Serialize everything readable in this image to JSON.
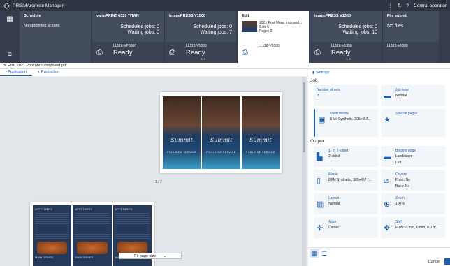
{
  "app": {
    "title": "PRISMAremote Manager",
    "user_menu": "Central operator"
  },
  "dashboard": {
    "schedule": {
      "header": "Schedule",
      "text": "No upcoming actions"
    },
    "printers": [
      {
        "name": "varioPRINT 6320 TITAN",
        "line1": "Scheduled jobs: 0",
        "line2": "Waiting jobs: 0",
        "server": "LL118-VP6000",
        "state": "Ready"
      },
      {
        "name": "imagePRESS V1000",
        "line1": "Scheduled jobs: 0",
        "line2": "Waiting jobs: 7",
        "server": "LL118-V1000",
        "state": "Ready"
      },
      {
        "name": "imagePRESS V1350",
        "line1": "Scheduled jobs: 0",
        "line2": "Waiting jobs: 10",
        "server": "LL118-V1350",
        "state": "Ready"
      }
    ],
    "edit": {
      "header": "Edit",
      "file": "2021 Pool Menu Imposed...",
      "sets": "Sets 5",
      "pages": "Pages 2",
      "server": "LL118-V1000"
    },
    "file_submit": {
      "header": "File submit",
      "text": "No files",
      "server": "LL118-V1000"
    }
  },
  "filebar": {
    "label": "Edit: 2021 Pool Menu Imposed.pdf"
  },
  "tabs": [
    {
      "label": "Application"
    },
    {
      "label": "Production"
    }
  ],
  "preview": {
    "menu_title": "Summit",
    "menu_brand": "TAVERNA",
    "menu_sub": "POOLSIDE SERVICE",
    "page_label": "1 / 2",
    "page2_heading": "APPETIZERS",
    "page2_footer": "MAIN DISHES",
    "zoom": "Fit page size"
  },
  "settings": {
    "header": "Settings",
    "job_label": "Job",
    "job": [
      {
        "title": "Number of sets",
        "value": "5",
        "icon": "sets-icon"
      },
      {
        "title": "Job type",
        "value": "Normal",
        "icon": "job-type-icon"
      },
      {
        "title": "Used media",
        "value": "8 Mil Synthetic, 305x457...",
        "icon": "media-icon"
      },
      {
        "title": "Special pages",
        "value": "",
        "icon": "special-pages-icon"
      }
    ],
    "output_label": "Output",
    "output": [
      {
        "title": "1- or 2-sided",
        "value": "2-sided",
        "icon": "sided-icon"
      },
      {
        "title": "Binding edge",
        "value": "Landscape",
        "value2": "Left",
        "icon": "binding-icon"
      },
      {
        "title": "Media",
        "value": "8 Mil Synthetic, 305x457 (...",
        "icon": "media-icon"
      },
      {
        "title": "Covers",
        "value": "Front: No",
        "value2": "Back: No",
        "icon": "covers-icon"
      },
      {
        "title": "Layout",
        "value": "Normal",
        "icon": "layout-icon"
      },
      {
        "title": "Zoom",
        "value": "100%",
        "icon": "zoom-icon"
      },
      {
        "title": "Align",
        "value": "Center",
        "icon": "align-icon"
      },
      {
        "title": "Shift",
        "value": "Front: 0 mm, 0 mm, 0.0 m...",
        "icon": "shift-icon"
      }
    ],
    "cancel": "Cancel"
  }
}
